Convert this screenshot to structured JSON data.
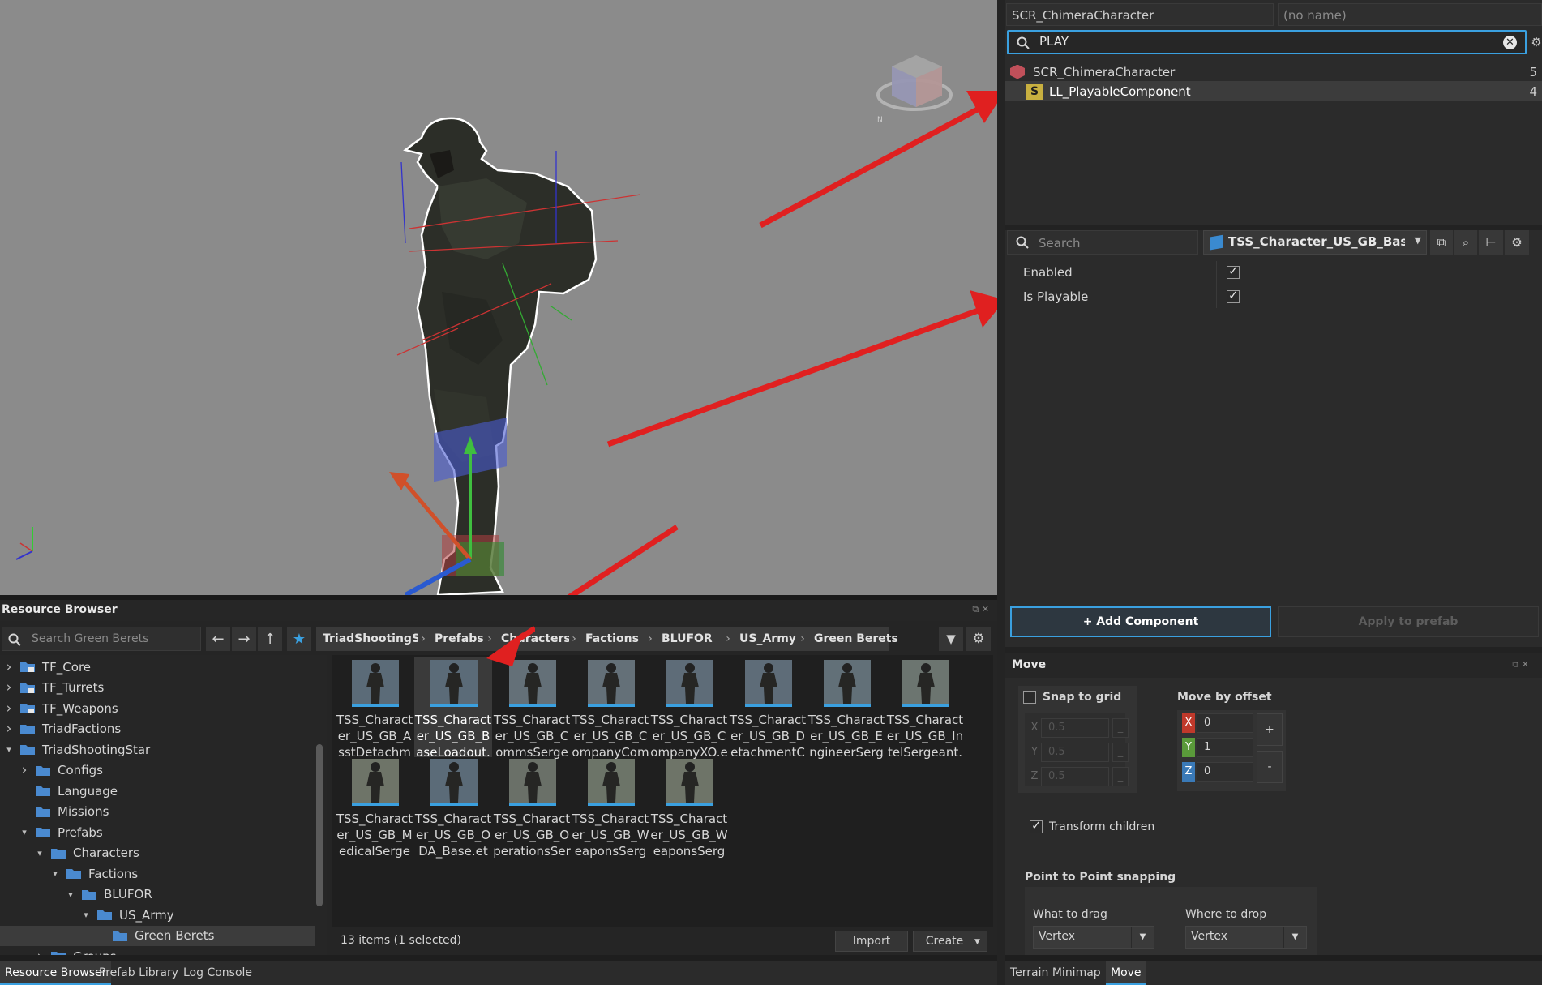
{
  "entity": {
    "class_name": "SCR_ChimeraCharacter",
    "name_placeholder": "(no name)"
  },
  "component_search": {
    "value": "PLAY",
    "results": [
      {
        "label": "SCR_ChimeraCharacter",
        "count": "5"
      },
      {
        "label": "LL_PlayableComponent",
        "count": "4"
      }
    ]
  },
  "properties": {
    "search_placeholder": "Search",
    "prefab_name": "TSS_Character_US_GB_BaseLo",
    "rows": [
      {
        "label": "Enabled",
        "checked": true
      },
      {
        "label": "Is Playable",
        "checked": true
      }
    ],
    "add_component": "+ Add Component",
    "apply_to_prefab": "Apply to prefab"
  },
  "resource_browser": {
    "title": "Resource Browser",
    "search_placeholder": "Search Green Berets",
    "breadcrumbs": [
      "TriadShootingStar",
      "Prefabs",
      "Characters",
      "Factions",
      "BLUFOR",
      "US_Army",
      "Green Berets"
    ],
    "tree": [
      {
        "label": "TF_Core",
        "depth": 0,
        "arrow": "right",
        "locked": true
      },
      {
        "label": "TF_Turrets",
        "depth": 0,
        "arrow": "right",
        "locked": true
      },
      {
        "label": "TF_Weapons",
        "depth": 0,
        "arrow": "right",
        "locked": true
      },
      {
        "label": "TriadFactions",
        "depth": 0,
        "arrow": "right",
        "locked": false
      },
      {
        "label": "TriadShootingStar",
        "depth": 0,
        "arrow": "down",
        "locked": false
      },
      {
        "label": "Configs",
        "depth": 1,
        "arrow": "right",
        "locked": false
      },
      {
        "label": "Language",
        "depth": 1,
        "arrow": "",
        "locked": false
      },
      {
        "label": "Missions",
        "depth": 1,
        "arrow": "",
        "locked": false
      },
      {
        "label": "Prefabs",
        "depth": 1,
        "arrow": "down",
        "locked": false
      },
      {
        "label": "Characters",
        "depth": 2,
        "arrow": "down",
        "locked": false
      },
      {
        "label": "Factions",
        "depth": 3,
        "arrow": "down",
        "locked": false
      },
      {
        "label": "BLUFOR",
        "depth": 4,
        "arrow": "down",
        "locked": false
      },
      {
        "label": "US_Army",
        "depth": 5,
        "arrow": "down",
        "locked": false
      },
      {
        "label": "Green Berets",
        "depth": 6,
        "arrow": "",
        "locked": false,
        "selected": true
      },
      {
        "label": "Groups",
        "depth": 2,
        "arrow": "right",
        "locked": false
      }
    ],
    "items": [
      {
        "name": "TSS_Character_US_GB_AsstDetachme",
        "selected": false
      },
      {
        "name": "TSS_Character_US_GB_BaseLoadout.",
        "selected": true
      },
      {
        "name": "TSS_Character_US_GB_CommsSerge",
        "selected": false
      },
      {
        "name": "TSS_Character_US_GB_CompanyCom",
        "selected": false
      },
      {
        "name": "TSS_Character_US_GB_CompanyXO.e",
        "selected": false
      },
      {
        "name": "TSS_Character_US_GB_DetachmentC",
        "selected": false
      },
      {
        "name": "TSS_Character_US_GB_EngineerSerge",
        "selected": false
      },
      {
        "name": "TSS_Character_US_GB_IntelSergeant.",
        "selected": false
      },
      {
        "name": "TSS_Character_US_GB_MedicalSergea",
        "selected": false
      },
      {
        "name": "TSS_Character_US_GB_ODA_Base.et",
        "selected": false
      },
      {
        "name": "TSS_Character_US_GB_OperationsSer",
        "selected": false
      },
      {
        "name": "TSS_Character_US_GB_WeaponsSerg",
        "selected": false
      },
      {
        "name": "TSS_Character_US_GB_WeaponsSerg",
        "selected": false
      }
    ],
    "status": "13 items (1 selected)",
    "import_label": "Import",
    "create_label": "Create"
  },
  "bottom_tabs_left": [
    "Resource Browser",
    "Prefab Library",
    "Log Console"
  ],
  "bottom_tabs_right": [
    "Terrain Minimap",
    "Move"
  ],
  "move_panel": {
    "title": "Move",
    "snap_to_grid": "Snap to grid",
    "snap_values": {
      "x": "0.5",
      "y": "0.5",
      "z": "0.5"
    },
    "move_by_offset": "Move by offset",
    "offset_values": {
      "x": "0",
      "y": "1",
      "z": "0"
    },
    "plus": "+",
    "minus": "-",
    "transform_children": "Transform children",
    "point_to_point": "Point to Point snapping",
    "what_to_drag": "What to drag",
    "where_to_drop": "Where to drop",
    "drag_value": "Vertex",
    "drop_value": "Vertex"
  },
  "axis_letters": {
    "x": "X",
    "y": "Y",
    "z": "Z"
  },
  "colors": {
    "accent": "#3aa0e0",
    "annotation_arrow": "#e02020",
    "axis_x": "#c0392b",
    "axis_y": "#5a9a3a",
    "axis_z": "#3a7ab8"
  }
}
